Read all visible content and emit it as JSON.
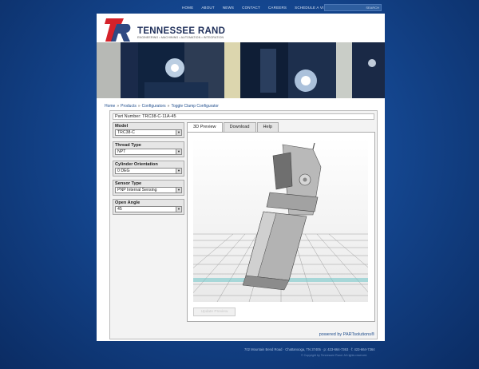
{
  "nav": [
    "HOME",
    "ABOUT",
    "NEWS",
    "CONTACT",
    "CAREERS",
    "SCHEDULE A VISIT",
    "MEDIA"
  ],
  "search_label": "SEARCH",
  "brand": "TENNESSEE RAND",
  "tagline": "ENGINEERING • MACHINING • AUTOMATION • INTEGRATION",
  "breadcrumb": [
    "Home",
    "Products",
    "Configurators",
    "Toggle Clamp Configurator"
  ],
  "part_number": "Part Number: TRC38-C-11A-45",
  "options": [
    {
      "label": "Model",
      "value": "TRC38-C"
    },
    {
      "label": "Thread Type",
      "value": "NPT"
    },
    {
      "label": "Cylinder Orientation",
      "value": "0 DEG"
    },
    {
      "label": "Sensor Type",
      "value": "PNP Internal Sensing"
    },
    {
      "label": "Open Angle",
      "value": "45"
    }
  ],
  "tabs": [
    "3D Preview",
    "Download",
    "Help"
  ],
  "update_button": "Update Preview",
  "powered_by": "powered by PARTsolutions®",
  "footer_address": "702 Mountain Bend Road · Chattanooga, TN 37405 · p: 423-664-7363 · f: 423-664-7364",
  "footer_copy": "© Copyright by Tennessee Rand. All rights reserved."
}
